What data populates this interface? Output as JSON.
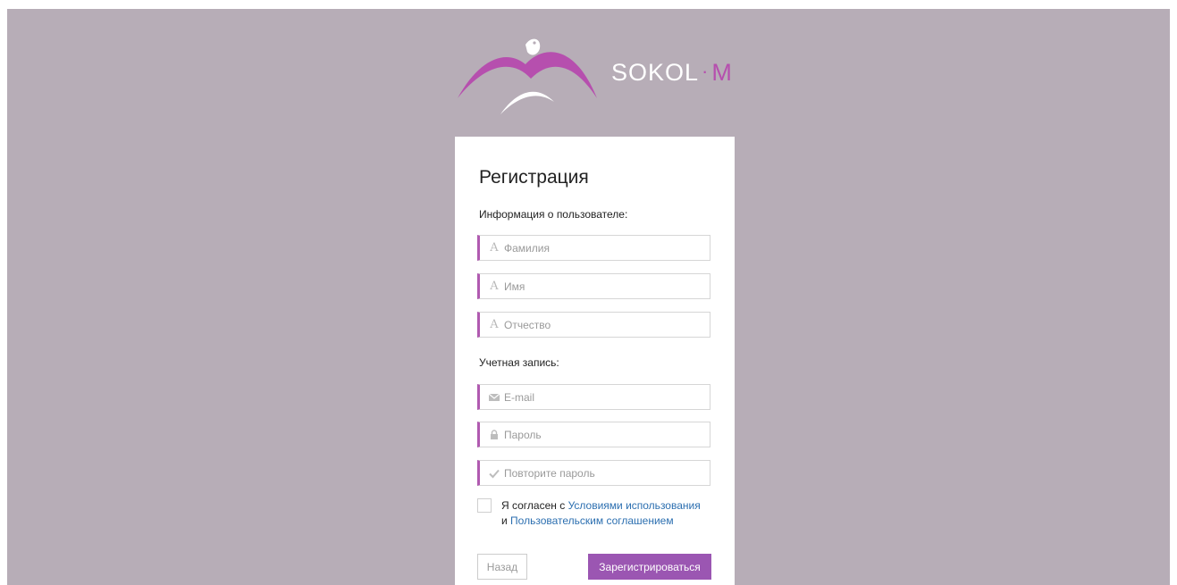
{
  "brand": {
    "name": "SOKOL",
    "separator": "·",
    "suffix": "M",
    "accent_color": "#b64fae",
    "background_color": "#b7adb7"
  },
  "form": {
    "title": "Регистрация",
    "user_section_label": "Информация о пользователе:",
    "account_section_label": "Учетная запись:",
    "fields": {
      "last_name": {
        "placeholder": "Фамилия",
        "value": "",
        "icon": "text-a-icon"
      },
      "first_name": {
        "placeholder": "Имя",
        "value": "",
        "icon": "text-a-icon"
      },
      "middle_name": {
        "placeholder": "Отчество",
        "value": "",
        "icon": "text-a-icon"
      },
      "email": {
        "placeholder": "E-mail",
        "value": "",
        "icon": "envelope-icon"
      },
      "password": {
        "placeholder": "Пароль",
        "value": "",
        "icon": "lock-icon"
      },
      "password_repeat": {
        "placeholder": "Повторите пароль",
        "value": "",
        "icon": "check-icon"
      }
    },
    "agreement": {
      "checked": false,
      "prefix": "Я согласен с ",
      "terms_link": "Условиями использования",
      "middle": "и ",
      "user_agreement_link": "Пользовательским соглашением"
    },
    "buttons": {
      "back": "Назад",
      "register": "Зарегистрироваться"
    }
  }
}
